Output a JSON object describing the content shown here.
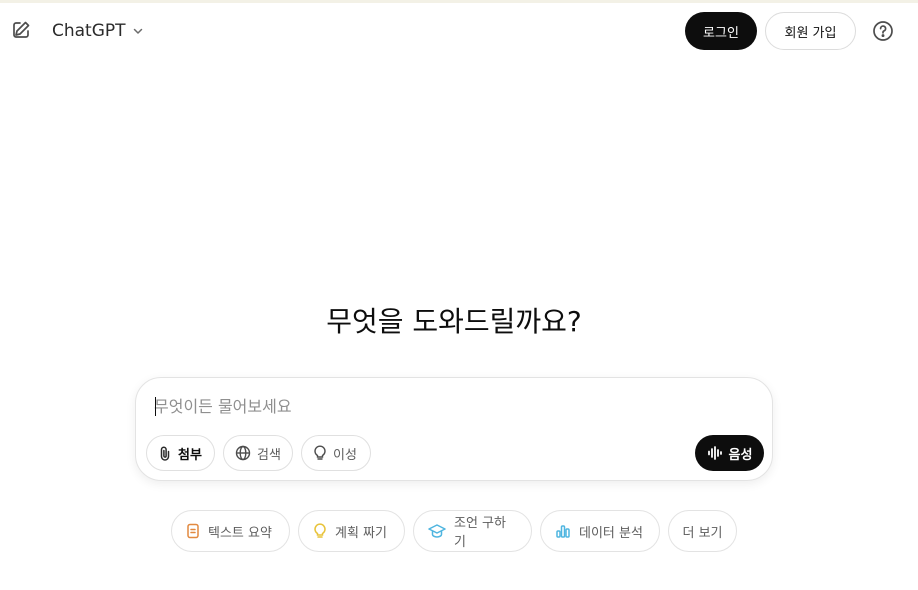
{
  "header": {
    "model_name": "ChatGPT",
    "login_label": "로그인",
    "signup_label": "회원 가입",
    "icons": [
      "edit-icon",
      "chevron-down-icon",
      "help-icon"
    ]
  },
  "main": {
    "title": "무엇을 도와드릴까요?"
  },
  "composer": {
    "placeholder": "무엇이든 물어보세요",
    "value": "",
    "attach_label": "첨부",
    "search_label": "검색",
    "reason_label": "이성",
    "voice_label": "음성"
  },
  "suggestions": [
    {
      "label": "텍스트 요약",
      "icon": "document-icon",
      "color": "#e2893f"
    },
    {
      "label": "계획 짜기",
      "icon": "lightbulb-icon",
      "color": "#e8c33a"
    },
    {
      "label": "조언 구하기",
      "icon": "graduation-cap-icon",
      "color": "#4fb5e0"
    },
    {
      "label": "데이터 분석",
      "icon": "bar-chart-icon",
      "color": "#4fb5e0"
    },
    {
      "label": "더 보기"
    }
  ],
  "colors": {
    "primary_button": "#0d0d0d",
    "border": "#e3e3e3",
    "muted_text": "#5d5d5d"
  }
}
